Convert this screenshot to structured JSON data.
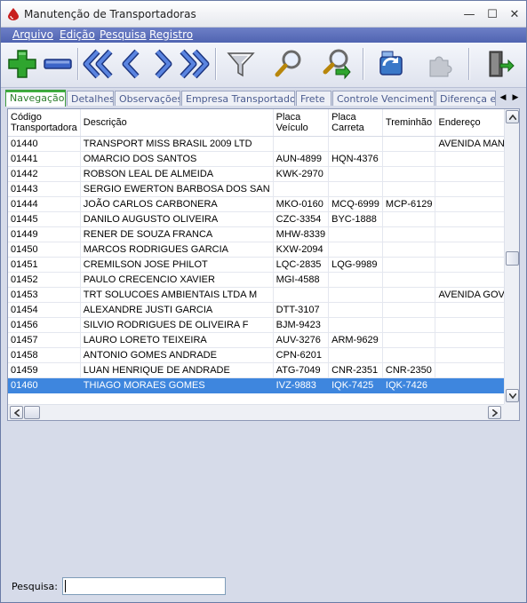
{
  "window": {
    "title": "Manutenção de Transportadoras",
    "minimize_glyph": "—",
    "maximize_glyph": "☐",
    "close_glyph": "✕"
  },
  "menu": {
    "items": [
      {
        "label": "Arquivo"
      },
      {
        "label": "Edição"
      },
      {
        "label": "Pesquisa"
      },
      {
        "label": "Registro"
      }
    ]
  },
  "toolbar": {
    "buttons": [
      {
        "icon": "add-icon",
        "name": "add-button"
      },
      {
        "icon": "remove-icon",
        "name": "remove-button"
      },
      {
        "icon": "first-record-icon",
        "name": "first-button"
      },
      {
        "icon": "previous-record-icon",
        "name": "previous-button"
      },
      {
        "icon": "next-record-icon",
        "name": "next-button"
      },
      {
        "icon": "last-record-icon",
        "name": "last-button"
      },
      {
        "icon": "filter-icon",
        "name": "filter-button"
      },
      {
        "icon": "search-icon",
        "name": "search-button"
      },
      {
        "icon": "search-go-icon",
        "name": "search-go-button"
      },
      {
        "icon": "refresh-icon",
        "name": "refresh-button"
      },
      {
        "icon": "disabled-puzzle-icon",
        "name": "disabled-button"
      },
      {
        "icon": "exit-door-icon",
        "name": "exit-button"
      }
    ],
    "colors": {
      "green": "#2fa52f",
      "blue": "#3b64c8"
    }
  },
  "tabs": {
    "items": [
      {
        "label": "Navegação",
        "active": true
      },
      {
        "label": "Detalhes"
      },
      {
        "label": "Observações"
      },
      {
        "label": "Empresa Transportadora"
      },
      {
        "label": "Frete"
      },
      {
        "label": "Controle Vencimentos"
      },
      {
        "label": "Diferença em"
      }
    ],
    "scroll_left": "◀",
    "scroll_right": "▶"
  },
  "grid": {
    "columns": [
      {
        "label": "Código Transportadora"
      },
      {
        "label": "Descrição"
      },
      {
        "label": "Placa Veículo"
      },
      {
        "label": "Placa Carreta"
      },
      {
        "label": "Treminhão"
      },
      {
        "label": "Endereço"
      }
    ],
    "rows": [
      {
        "codigo": "01440",
        "descricao": "TRANSPORT MISS BRASIL 2009 LTD",
        "placa_veiculo": "",
        "placa_carreta": "",
        "treminhao": "",
        "endereco": "AVENIDA MANOEL"
      },
      {
        "codigo": "01441",
        "descricao": "OMARCIO DOS SANTOS",
        "placa_veiculo": "AUN-4899",
        "placa_carreta": "HQN-4376",
        "treminhao": "",
        "endereco": ""
      },
      {
        "codigo": "01442",
        "descricao": "ROBSON LEAL DE ALMEIDA",
        "placa_veiculo": "KWK-2970",
        "placa_carreta": "",
        "treminhao": "",
        "endereco": ""
      },
      {
        "codigo": "01443",
        "descricao": "SERGIO EWERTON BARBOSA DOS SAN",
        "placa_veiculo": "",
        "placa_carreta": "",
        "treminhao": "",
        "endereco": ""
      },
      {
        "codigo": "01444",
        "descricao": "JOÃO CARLOS CARBONERA",
        "placa_veiculo": "MKO-0160",
        "placa_carreta": "MCQ-6999",
        "treminhao": "MCP-6129",
        "endereco": ""
      },
      {
        "codigo": "01445",
        "descricao": "DANILO AUGUSTO OLIVEIRA",
        "placa_veiculo": "CZC-3354",
        "placa_carreta": "BYC-1888",
        "treminhao": "",
        "endereco": ""
      },
      {
        "codigo": "01449",
        "descricao": "RENER DE SOUZA FRANCA",
        "placa_veiculo": "MHW-8339",
        "placa_carreta": "",
        "treminhao": "",
        "endereco": ""
      },
      {
        "codigo": "01450",
        "descricao": "MARCOS RODRIGUES GARCIA",
        "placa_veiculo": "KXW-2094",
        "placa_carreta": "",
        "treminhao": "",
        "endereco": ""
      },
      {
        "codigo": "01451",
        "descricao": "CREMILSON JOSE PHILOT",
        "placa_veiculo": "LQC-2835",
        "placa_carreta": "LQG-9989",
        "treminhao": "",
        "endereco": ""
      },
      {
        "codigo": "01452",
        "descricao": "PAULO CRECENCIO XAVIER",
        "placa_veiculo": "MGI-4588",
        "placa_carreta": "",
        "treminhao": "",
        "endereco": ""
      },
      {
        "codigo": "01453",
        "descricao": "TRT SOLUCOES AMBIENTAIS LTDA M",
        "placa_veiculo": "",
        "placa_carreta": "",
        "treminhao": "",
        "endereco": "AVENIDA GOVERN"
      },
      {
        "codigo": "01454",
        "descricao": "ALEXANDRE JUSTI GARCIA",
        "placa_veiculo": "DTT-3107",
        "placa_carreta": "",
        "treminhao": "",
        "endereco": ""
      },
      {
        "codigo": "01456",
        "descricao": "SILVIO RODRIGUES DE OLIVEIRA F",
        "placa_veiculo": "BJM-9423",
        "placa_carreta": "",
        "treminhao": "",
        "endereco": ""
      },
      {
        "codigo": "01457",
        "descricao": "LAURO LORETO TEIXEIRA",
        "placa_veiculo": "AUV-3276",
        "placa_carreta": "ARM-9629",
        "treminhao": "",
        "endereco": ""
      },
      {
        "codigo": "01458",
        "descricao": "ANTONIO GOMES ANDRADE",
        "placa_veiculo": "CPN-6201",
        "placa_carreta": "",
        "treminhao": "",
        "endereco": ""
      },
      {
        "codigo": "01459",
        "descricao": "LUAN HENRIQUE DE ANDRADE",
        "placa_veiculo": "ATG-7049",
        "placa_carreta": "CNR-2351",
        "treminhao": "CNR-2350",
        "endereco": ""
      },
      {
        "codigo": "01460",
        "descricao": "THIAGO MORAES GOMES",
        "placa_veiculo": "IVZ-9883",
        "placa_carreta": "IQK-7425",
        "treminhao": "IQK-7426",
        "endereco": "",
        "selected": true
      }
    ],
    "selection_color": "#3e86de"
  },
  "search": {
    "label": "Pesquisa:",
    "value": ""
  }
}
